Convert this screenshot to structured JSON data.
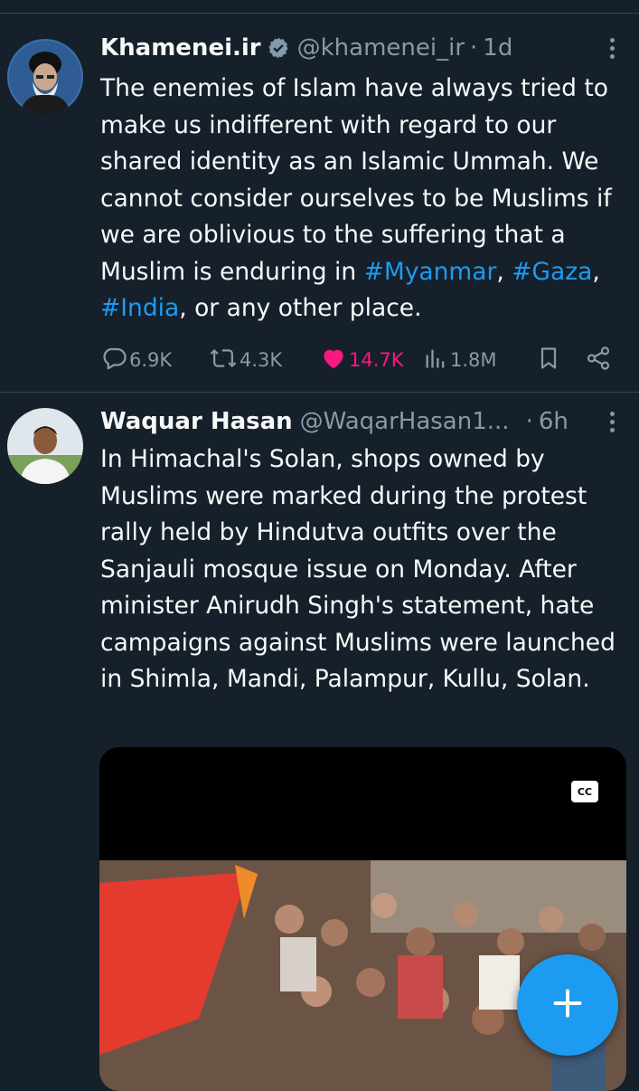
{
  "tweets": [
    {
      "display_name": "Khamenei.ir",
      "verified": true,
      "handle": "@khamenei_ir",
      "separator": "·",
      "time": "1d",
      "text_parts": [
        "The enemies of Islam have always tried to make us indifferent with regard to our shared identity as an Islamic Ummah. We cannot consider ourselves to be Muslims if we are oblivious to the suffering that a Muslim is enduring in ",
        "#Myanmar",
        ", ",
        "#Gaza",
        ", ",
        "#India",
        ", or any other place."
      ],
      "stats": {
        "replies": "6.9K",
        "reposts": "4.3K",
        "likes": "14.7K",
        "views": "1.8M"
      }
    },
    {
      "display_name": "Waquar Hasan",
      "handle": "@WaqarHasan1...",
      "separator": "·",
      "time": "6h",
      "text": "In Himachal's Solan, shops owned by Muslims were marked during the protest rally held by Hindutva outfits over the Sanjauli mosque issue on Monday. After minister Anirudh Singh's statement, hate campaigns against Muslims were launched in Shimla, Mandi, Palampur, Kullu, Solan.",
      "media": {
        "captions_badge": "CC"
      }
    }
  ],
  "colors": {
    "background": "#15202b",
    "accent": "#1d9bf0",
    "like": "#f91880",
    "secondary_text": "#8b98a5"
  },
  "icons": [
    "reply-icon",
    "repost-icon",
    "like-icon",
    "views-icon",
    "bookmark-icon",
    "share-icon",
    "verified-badge-icon",
    "more-icon",
    "compose-plus-icon"
  ]
}
